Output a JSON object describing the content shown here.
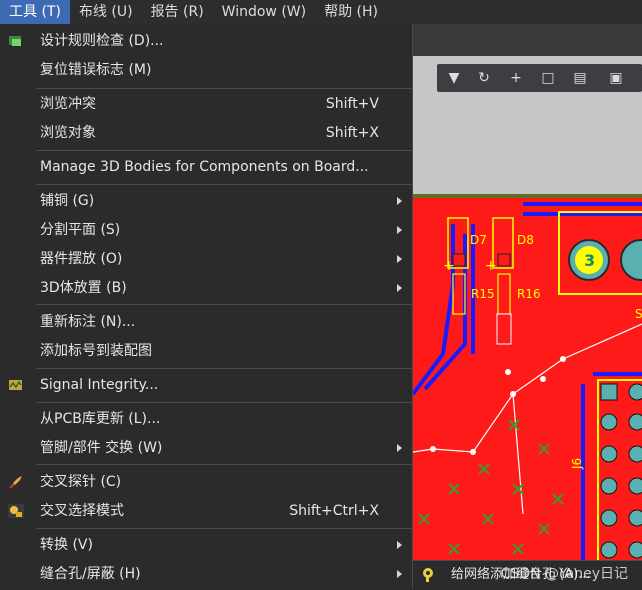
{
  "menubar": {
    "items": [
      {
        "label": "工具 (T)",
        "active": true
      },
      {
        "label": "布线 (U)"
      },
      {
        "label": "报告 (R)"
      },
      {
        "label": "Window (W)"
      },
      {
        "label": "帮助 (H)"
      }
    ]
  },
  "menu": {
    "items": [
      {
        "label": "设计规则检查 (D)...",
        "shortcut": "",
        "icon": "drc-icon"
      },
      {
        "label": "复位错误标志 (M)",
        "shortcut": ""
      },
      {
        "label": "浏览冲突",
        "shortcut": "Shift+V"
      },
      {
        "label": "浏览对象",
        "shortcut": "Shift+X"
      },
      {
        "label": "Manage 3D Bodies for Components on Board...",
        "shortcut": ""
      },
      {
        "label": "铺铜 (G)",
        "submenu": true
      },
      {
        "label": "分割平面 (S)",
        "submenu": true
      },
      {
        "label": "器件摆放 (O)",
        "submenu": true
      },
      {
        "label": "3D体放置 (B)",
        "submenu": true
      },
      {
        "label": "重新标注 (N)...",
        "shortcut": ""
      },
      {
        "label": "添加标号到装配图",
        "shortcut": ""
      },
      {
        "label": "Signal Integrity...",
        "shortcut": "",
        "icon": "signal-integrity-icon"
      },
      {
        "label": "从PCB库更新 (L)...",
        "shortcut": ""
      },
      {
        "label": "管脚/部件 交换 (W)",
        "submenu": true
      },
      {
        "label": "交叉探针 (C)",
        "shortcut": "",
        "icon": "cross-probe-icon"
      },
      {
        "label": "交叉选择模式",
        "shortcut": "Shift+Ctrl+X",
        "icon": "cross-select-icon"
      },
      {
        "label": "转换 (V)",
        "submenu": true
      },
      {
        "label": "缝合孔/屏蔽 (H)",
        "submenu": true
      }
    ]
  },
  "submenu_peek": {
    "label": "给网络添加缝合孔 (A)..."
  },
  "watermark": "CSDN @Yaney日记",
  "pcb": {
    "labels": [
      "D7",
      "D8",
      "R15",
      "R16",
      "3",
      "J6",
      "S"
    ]
  },
  "colors": {
    "menu_bg": "#2b2b2b",
    "highlight": "#3d6bb3",
    "pcb_red": "#ff1a1a",
    "pcb_blue": "#1a1aff",
    "pcb_yellow": "#ffff00"
  }
}
